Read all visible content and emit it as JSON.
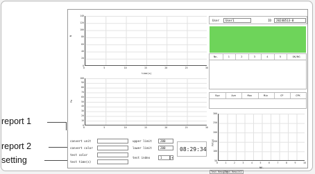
{
  "annotations": {
    "report1": "report 1",
    "report2": "report 2",
    "setting": "setting"
  },
  "header": {
    "user_label": "User",
    "user_value": "User1",
    "id_label": "ID",
    "id_value": "20240513-0"
  },
  "result_table": {
    "columns": [
      "No.",
      "1",
      "2",
      "3",
      "4",
      "5",
      "OK/NG"
    ],
    "status_color": "#6ed45a"
  },
  "stats_table": {
    "columns": [
      "Rpv",
      "Ave",
      "Max",
      "Min",
      "CP",
      "CPK"
    ]
  },
  "chart_top": {
    "ylabel": "N",
    "xlabel": "time(s)",
    "yticks": [
      "140",
      "120",
      "100",
      "80",
      "60",
      "40",
      "20",
      "0"
    ],
    "xticks": [
      "0",
      "5",
      "10",
      "15",
      "20",
      "25",
      "30"
    ]
  },
  "chart_mid": {
    "ylabel": "Pa",
    "xlabel": "time(s)",
    "yticks": [
      "100",
      "90",
      "80",
      "70",
      "60",
      "50",
      "40",
      "30",
      "20",
      "10",
      "0"
    ],
    "xticks": [
      "0",
      "5",
      "10",
      "15",
      "20",
      "25",
      "30"
    ]
  },
  "chart_right": {
    "ylabel": "Value",
    "xlabel": "NO.",
    "yticks": [
      "300",
      "250",
      "200",
      "150",
      "100",
      "50"
    ],
    "xticks": [
      "0",
      "1",
      "2",
      "3",
      "4",
      "5",
      "6",
      "7",
      "8",
      "9",
      "10"
    ],
    "legend": [
      "Test Result",
      "Test Result2"
    ]
  },
  "form": {
    "convert_unit": "convert unit",
    "convert_color": "convert color",
    "test_color": "test color",
    "test_time": "test time(s)",
    "upper_limit": "upper limit",
    "upper_value": "200",
    "lower_limit": "lower limit",
    "lower_value": "200",
    "test_index": "test index",
    "test_index_value": "1",
    "clock": "08:29:34"
  }
}
